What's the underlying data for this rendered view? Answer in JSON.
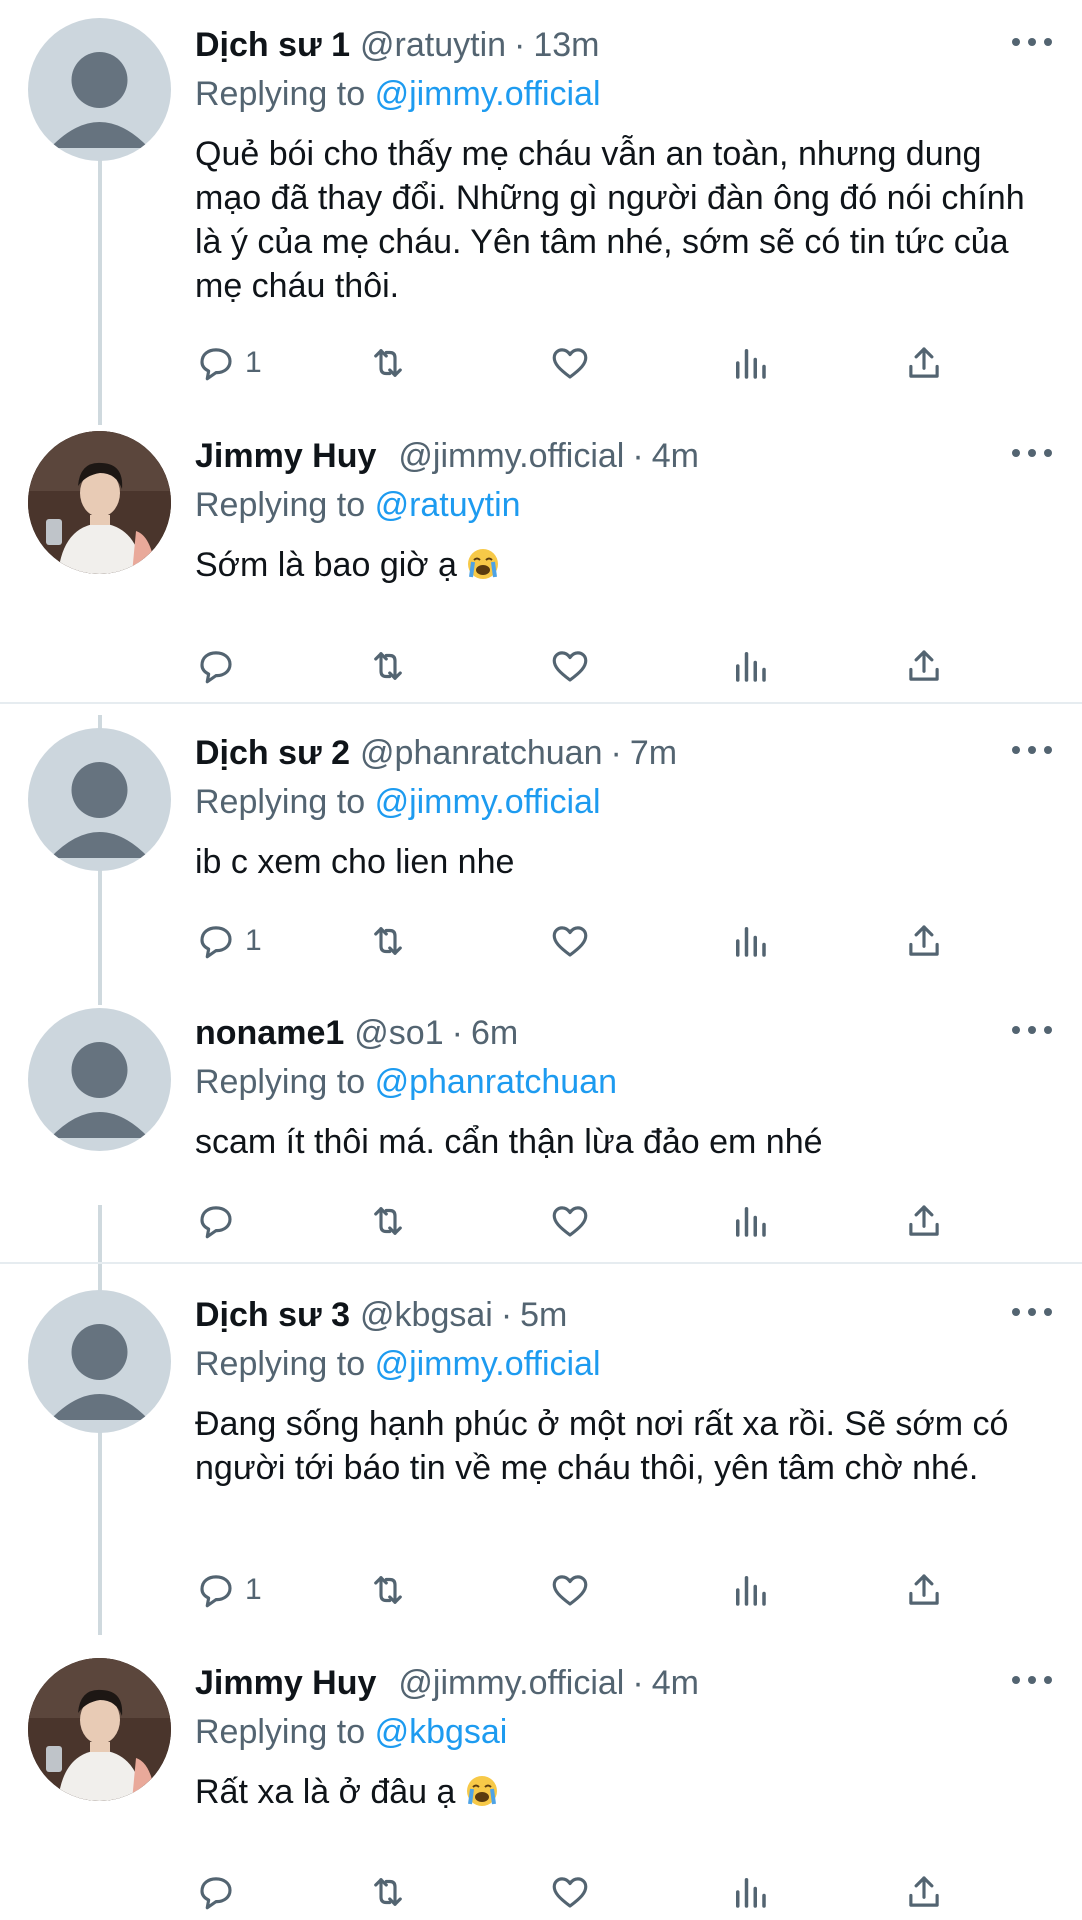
{
  "tweets": [
    {
      "name": "Dịch sư 1",
      "handle": "@ratuytin",
      "time": "13m",
      "replying_prefix": "Replying to",
      "replying_to": "@jimmy.official",
      "text": "Quẻ bói cho thấy mẹ cháu vẫn an toàn, nhưng dung mạo đã thay đổi. Những gì người đàn ông đó nói chính là ý của mẹ cháu. Yên tâm nhé, sớm sẽ có tin tức của mẹ cháu thôi.",
      "reply_count": "1",
      "avatar": "default-avatar"
    },
    {
      "name": "Jimmy Huy",
      "handle": "@jimmy.official",
      "time": "4m",
      "replying_prefix": "Replying to",
      "replying_to": "@ratuytin",
      "text": "Sớm là bao giờ ạ",
      "emoji": "loudly-crying-face",
      "reply_count": "",
      "avatar": "photo-avatar"
    },
    {
      "name": "Dịch sư 2",
      "handle": "@phanratchuan",
      "time": "7m",
      "replying_prefix": "Replying to",
      "replying_to": "@jimmy.official",
      "text": "ib c xem cho lien nhe",
      "reply_count": "1",
      "avatar": "default-avatar"
    },
    {
      "name": "noname1",
      "handle": "@so1",
      "time": "6m",
      "replying_prefix": "Replying to",
      "replying_to": "@phanratchuan",
      "text": "scam ít thôi má. cẩn thận lừa đảo em nhé",
      "reply_count": "",
      "avatar": "default-avatar"
    },
    {
      "name": "Dịch sư 3",
      "handle": "@kbgsai",
      "time": "5m",
      "replying_prefix": "Replying to",
      "replying_to": "@jimmy.official",
      "text": "Đang sống hạnh phúc ở một nơi rất xa rồi. Sẽ sớm có người tới báo tin về mẹ cháu thôi, yên tâm chờ nhé.",
      "reply_count": "1",
      "avatar": "default-avatar"
    },
    {
      "name": "Jimmy Huy",
      "handle": "@jimmy.official",
      "time": "4m",
      "replying_prefix": "Replying to",
      "replying_to": "@kbgsai",
      "text": "Rất xa là ở đâu ạ",
      "emoji": "loudly-crying-face",
      "reply_count": "",
      "avatar": "photo-avatar"
    }
  ],
  "icons": {
    "reply": "reply-icon",
    "retweet": "retweet-icon",
    "like": "heart-icon",
    "views": "analytics-icon",
    "share": "share-icon",
    "more": "more-options-icon"
  },
  "colors": {
    "link": "#1d9bf0",
    "secondary_text": "#536471",
    "thread_line": "#cfd9de",
    "avatar_default": "#ccd6dd"
  }
}
